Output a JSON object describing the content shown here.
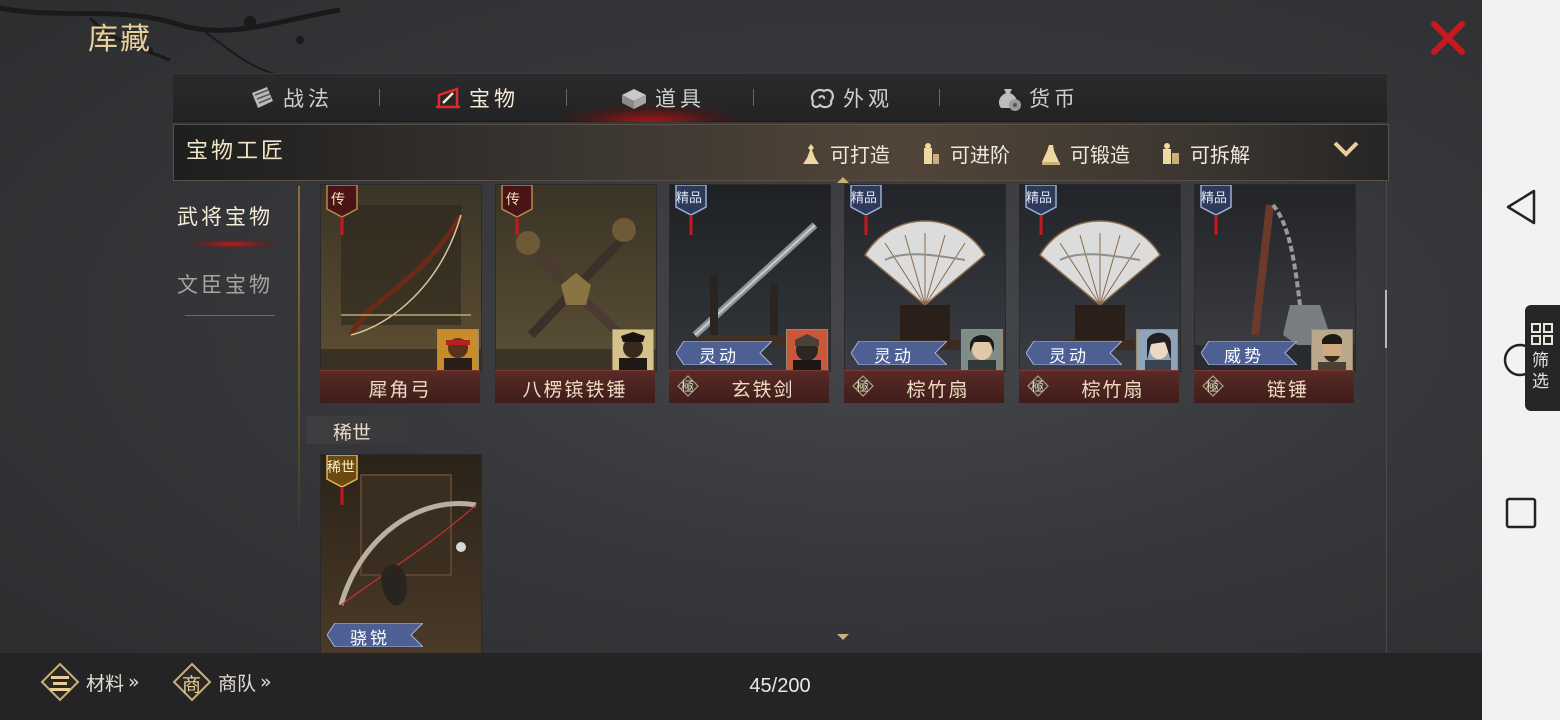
{
  "window": {
    "title": "库藏"
  },
  "tabs": [
    {
      "label": "战法",
      "icon": "scroll-icon"
    },
    {
      "label": "宝物",
      "icon": "treasure-icon",
      "active": true
    },
    {
      "label": "道具",
      "icon": "box-icon"
    },
    {
      "label": "外观",
      "icon": "cloud-swirl-icon"
    },
    {
      "label": "货币",
      "icon": "money-bag-icon"
    }
  ],
  "filter_bar": {
    "title": "宝物工匠",
    "filters": [
      {
        "label": "可打造",
        "icon": "craftsman-icon"
      },
      {
        "label": "可进阶",
        "icon": "craftsman-icon"
      },
      {
        "label": "可锻造",
        "icon": "craftsman-icon"
      },
      {
        "label": "可拆解",
        "icon": "craftsman-icon"
      }
    ]
  },
  "side_nav": [
    {
      "label": "武将宝物",
      "active": true
    },
    {
      "label": "文臣宝物"
    }
  ],
  "treasures": [
    {
      "name": "犀角弓",
      "rarity": "传",
      "grade": "",
      "skill": ""
    },
    {
      "name": "八楞镔铁锤",
      "rarity": "传",
      "grade": "",
      "skill": ""
    },
    {
      "name": "玄铁剑",
      "rarity": "精品",
      "grade": "極",
      "skill": "灵动"
    },
    {
      "name": "棕竹扇",
      "rarity": "精品",
      "grade": "極",
      "skill": "灵动"
    },
    {
      "name": "棕竹扇",
      "rarity": "精品",
      "grade": "極",
      "skill": "灵动"
    },
    {
      "name": "链锤",
      "rarity": "精品",
      "grade": "極",
      "skill": "威势"
    }
  ],
  "section": {
    "label": "稀世",
    "items": [
      {
        "rarity": "稀世",
        "skill": "骁锐"
      }
    ]
  },
  "bottom": {
    "materials_label": "材料",
    "materials_icon_char": "",
    "caravan_label": "商队",
    "caravan_icon_char": "商",
    "chevrons": "»",
    "count": "45/200"
  },
  "android": {
    "filter_label": "筛选"
  },
  "colors": {
    "accent_red": "#c8181f",
    "gold": "#e8cf9a",
    "nameplate": "#4a2220"
  }
}
